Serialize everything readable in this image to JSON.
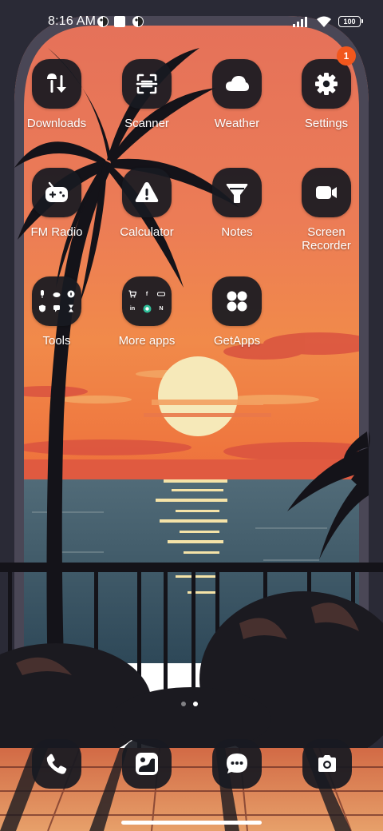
{
  "status_bar": {
    "time": "8:16 AM",
    "battery": "100"
  },
  "apps": [
    {
      "label": "Downloads",
      "icon": "downloads-icon"
    },
    {
      "label": "Scanner",
      "icon": "scanner-icon"
    },
    {
      "label": "Weather",
      "icon": "weather-cloud-icon"
    },
    {
      "label": "Settings",
      "icon": "gear-icon",
      "badge": "1"
    },
    {
      "label": "FM Radio",
      "icon": "radio-icon"
    },
    {
      "label": "Calculator",
      "icon": "calculator-icon"
    },
    {
      "label": "Notes",
      "icon": "notes-icon"
    },
    {
      "label_line1": "Screen",
      "label_line2": "Recorder",
      "icon": "screen-recorder-icon"
    },
    {
      "label": "Tools",
      "icon": "folder-icon"
    },
    {
      "label": "More apps",
      "icon": "folder-icon"
    },
    {
      "label": "GetApps",
      "icon": "getapps-icon"
    }
  ],
  "folder_more_apps": {
    "mini": [
      "cart",
      "f",
      "",
      "in",
      "",
      "N"
    ]
  },
  "dock": [
    {
      "name": "Phone",
      "icon": "phone-icon"
    },
    {
      "name": "Gallery",
      "icon": "gallery-icon"
    },
    {
      "name": "Messages",
      "icon": "messages-icon"
    },
    {
      "name": "Camera",
      "icon": "camera-icon"
    }
  ],
  "colors": {
    "accent_badge": "#f2571d",
    "icon_background": "#181a21",
    "sky_top": "#e8765a",
    "sky_bottom": "#f07a3a",
    "sea": "#3f5a68",
    "sun": "#f6e9b9"
  }
}
